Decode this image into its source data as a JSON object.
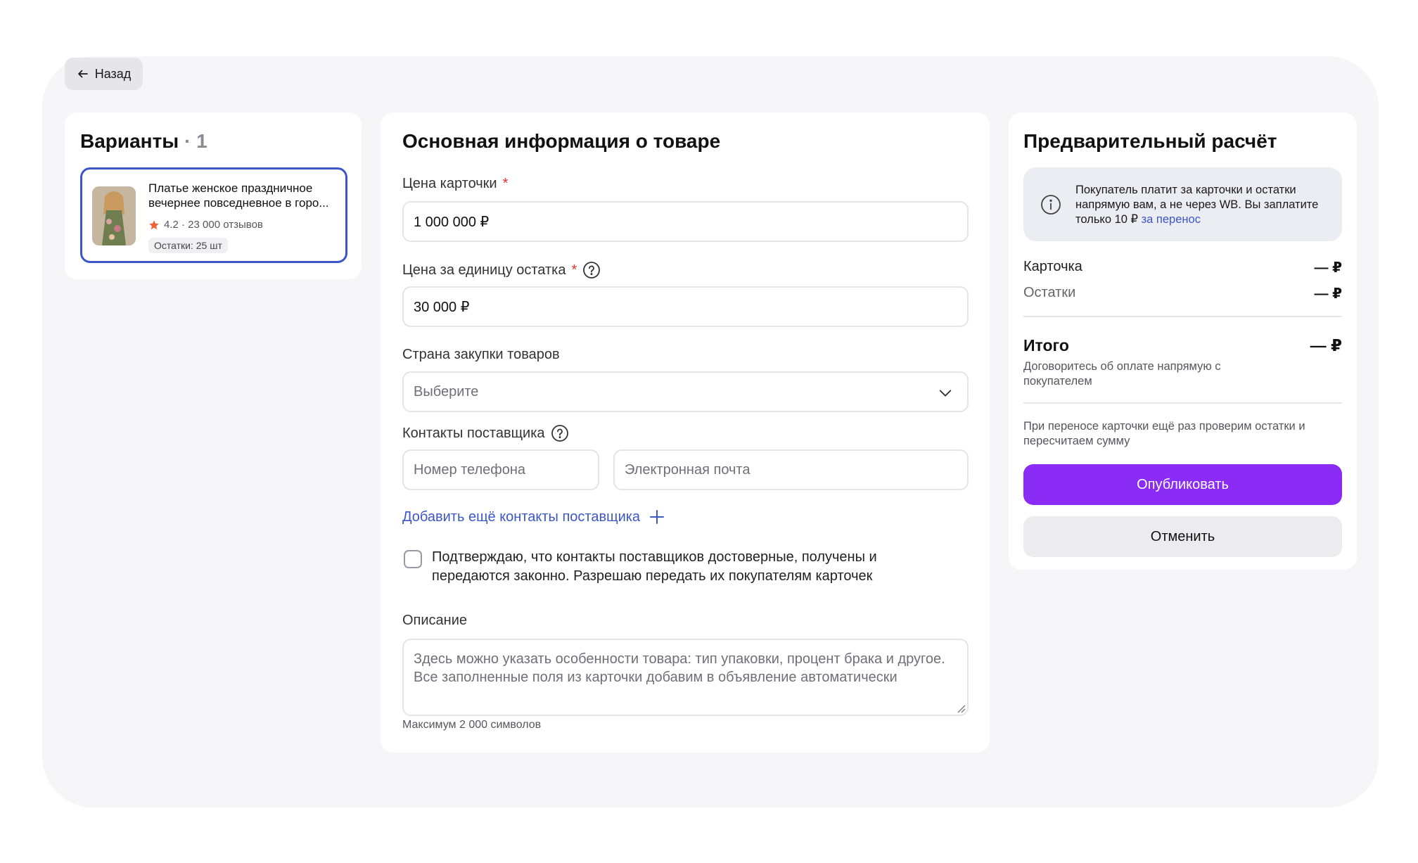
{
  "back": {
    "label": "Назад"
  },
  "variants": {
    "title": "Варианты",
    "count": "· 1",
    "item": {
      "name": "Платье женское праздничное вечернее повседневное в горо...",
      "rating": "4.2 · 23 000 отзывов",
      "stock": "Остатки: 25 шт"
    }
  },
  "main": {
    "title": "Основная информация о товаре",
    "price_card": {
      "label": "Цена карточки",
      "required": "*",
      "value": "1 000 000 ₽"
    },
    "price_unit": {
      "label": "Цена за единицу остатка",
      "required": "*",
      "value": "30 000 ₽"
    },
    "country": {
      "label": "Страна закупки товаров",
      "value": "Выберите"
    },
    "contacts": {
      "label": "Контакты поставщика",
      "phone_placeholder": "Номер телефона",
      "email_placeholder": "Электронная почта",
      "add_label": "Добавить ещё контакты поставщика"
    },
    "confirm_text": "Подтверждаю, что контакты поставщиков достоверные, получены и передаются законно. Разрешаю передать их покупателям карточек",
    "description": {
      "label": "Описание",
      "placeholder": "Здесь можно указать особенности товара: тип упаковки, процент брака и другое. Все заполненные поля из карточки добавим в объявление автоматически",
      "hint": "Максимум 2 000 символов"
    }
  },
  "calc": {
    "title": "Предварительный расчёт",
    "info_text": "Покупатель платит за карточки и остатки напрямую вам, а не через WB. Вы заплатите только 10 ₽",
    "info_link": "за перенос",
    "card_label": "Карточка",
    "card_value": "— ₽",
    "stock_label": "Остатки",
    "stock_value": "— ₽",
    "total_label": "Итого",
    "total_value": "— ₽",
    "total_note": "Договоритесь об оплате напрямую с покупателем",
    "transfer_note": "При переносе карточки ещё раз проверим остатки и пересчитаем сумму",
    "publish_label": "Опубликовать",
    "cancel_label": "Отменить"
  },
  "colors": {
    "accent": "#8a2cf6",
    "link": "#3d56c8",
    "required": "#e5352b",
    "selected_border": "#3d56c8"
  }
}
